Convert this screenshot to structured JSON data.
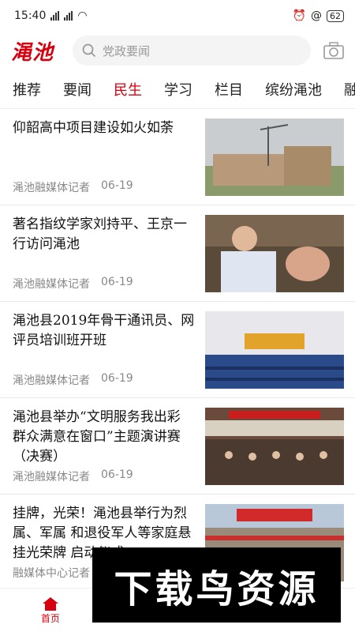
{
  "status": {
    "time": "15:40",
    "signal1": "4G",
    "signal2": "4G",
    "battery": "62"
  },
  "header": {
    "logo": "渑池",
    "search_placeholder": "党政要闻",
    "camera_icon": "camera-icon"
  },
  "tabs": [
    "推荐",
    "要闻",
    "民生",
    "学习",
    "栏目",
    "缤纷渑池",
    "融"
  ],
  "active_tab": 2,
  "news": [
    {
      "title": "仰韶高中项目建设如火如荼",
      "source": "渑池融媒体记者",
      "date": "06-19"
    },
    {
      "title": "著名指纹学家刘持平、王京一行访问渑池",
      "source": "渑池融媒体记者",
      "date": "06-19"
    },
    {
      "title": "渑池县2019年骨干通讯员、网评员培训班开班",
      "source": "渑池融媒体记者",
      "date": "06-19"
    },
    {
      "title": "渑池县举办“文明服务我出彩 群众满意在窗口”主题演讲赛（决赛）",
      "source": "渑池融媒体记者",
      "date": "06-19"
    },
    {
      "title": "挂牌，光荣！渑池县举行为烈属、军属 和退役军人等家庭悬挂光荣牌 启动仪式",
      "source": "融媒体中心记者",
      "date": ""
    }
  ],
  "bottom_nav": {
    "home": "首页",
    "home_icon": "home-icon"
  },
  "watermark": "下载鸟资源",
  "colors": {
    "accent": "#d7000f"
  }
}
